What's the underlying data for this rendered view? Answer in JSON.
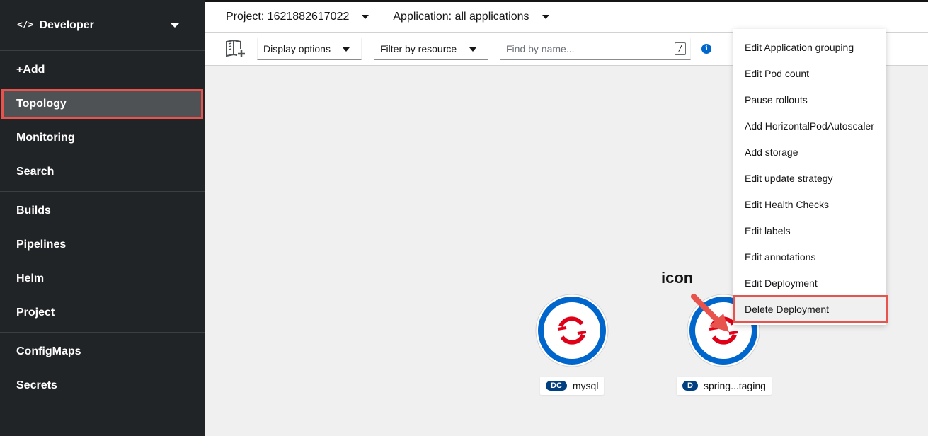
{
  "sidebar": {
    "perspective": "Developer",
    "groups": [
      [
        {
          "label": "+Add"
        },
        {
          "label": "Topology",
          "active": true
        },
        {
          "label": "Monitoring"
        },
        {
          "label": "Search"
        }
      ],
      [
        {
          "label": "Builds"
        },
        {
          "label": "Pipelines"
        },
        {
          "label": "Helm"
        },
        {
          "label": "Project"
        }
      ],
      [
        {
          "label": "ConfigMaps"
        },
        {
          "label": "Secrets"
        }
      ]
    ]
  },
  "topbar": {
    "project": "Project: 1621882617022",
    "application": "Application: all applications"
  },
  "toolbar": {
    "display_options": "Display options",
    "filter_by_resource": "Filter by resource",
    "search_placeholder": "Find by name...",
    "search_shortcut": "/"
  },
  "nodes": [
    {
      "badge": "DC",
      "name": "mysql"
    },
    {
      "badge": "D",
      "name": "spring...taging"
    }
  ],
  "context_menu": {
    "items": [
      "Edit Application grouping",
      "Edit Pod count",
      "Pause rollouts",
      "Add HorizontalPodAutoscaler",
      "Add storage",
      "Edit update strategy",
      "Edit Health Checks",
      "Edit labels",
      "Edit annotations",
      "Edit Deployment",
      "Delete Deployment"
    ]
  },
  "annotation": {
    "text": "icon"
  },
  "colors": {
    "sidebar_bg": "#212427",
    "highlight": "#e8534e",
    "node_ring": "#0066cc",
    "node_logo": "#e00017",
    "badge": "#004080"
  }
}
